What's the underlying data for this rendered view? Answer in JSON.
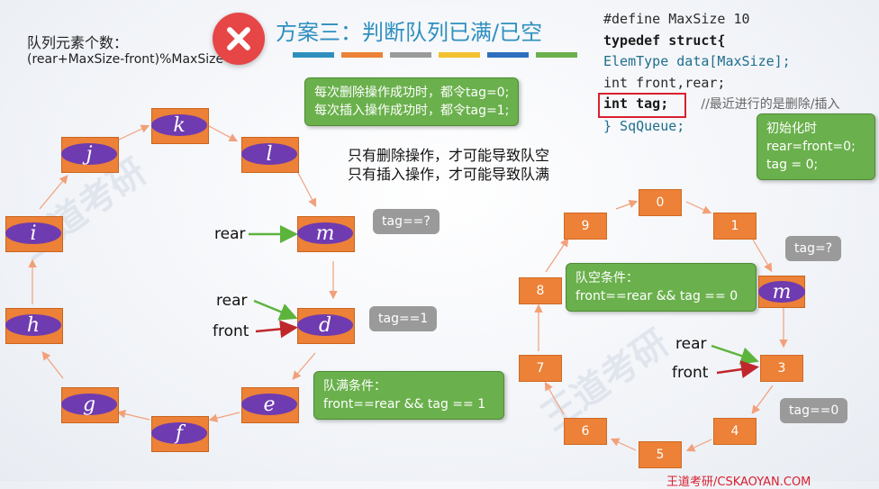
{
  "header": {
    "formula_label": "队列元素个数：",
    "formula": "(rear+MaxSize-front)%MaxSize",
    "title": "方案三：判断队列已满/已空",
    "stripe_colors": [
      "#2e8fbf",
      "#ec8137",
      "#9a9a9a",
      "#f2c12e",
      "#2e6fbf",
      "#6ab04c"
    ]
  },
  "code": {
    "line1": "#define MaxSize 10",
    "line2": "typedef struct{",
    "line3": "ElemType data[MaxSize];",
    "line4": "int front,rear;",
    "line5": "int tag;",
    "line5_comment": "//最近进行的是删除/插入",
    "line6": "} SqQueue;"
  },
  "notes": {
    "delete_insert_1": "每次删除操作成功时，都令tag=0;",
    "delete_insert_2": "每次插入操作成功时，都令tag=1;",
    "only_1": "只有删除操作，才可能导致队空",
    "only_2": "只有插入操作，才可能导致队满",
    "init_title": "初始化时",
    "init_1": "rear=front=0;",
    "init_2": "tag = 0;",
    "full_title": "队满条件：",
    "full_cond": "front==rear && tag == 1",
    "empty_title": "队空条件：",
    "empty_cond": "front==rear && tag == 0",
    "tag_q_left": "tag==?",
    "tag_1": "tag==1",
    "tag_q_right": "tag=?",
    "tag_0": "tag==0"
  },
  "left_ring": {
    "labels": [
      "k",
      "l",
      "m",
      "d",
      "e",
      "f",
      "g",
      "h",
      "i",
      "j"
    ],
    "rear_top": "rear",
    "rear_bottom": "rear",
    "front_bottom": "front"
  },
  "right_ring": {
    "labels": [
      "0",
      "1",
      "m",
      "3",
      "4",
      "5",
      "6",
      "7",
      "8",
      "9"
    ],
    "rear": "rear",
    "front": "front"
  },
  "footer": "王道考研/CSKAOYAN.COM",
  "colors": {
    "node": "#ec8137",
    "pill": "#6f3bb0",
    "green": "#6ab04c",
    "gray": "#9a9a9a",
    "rear_arrow": "#5cb43c",
    "front_arrow": "#c0272d"
  }
}
